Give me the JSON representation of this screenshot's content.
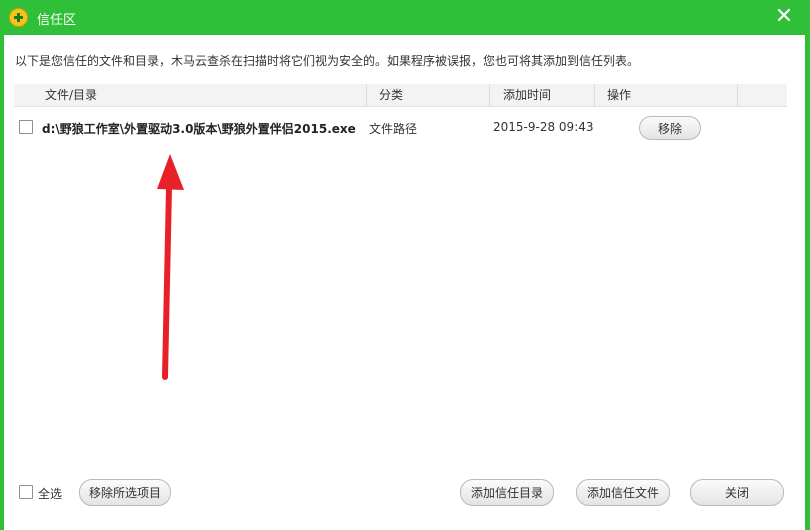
{
  "window": {
    "title": "信任区"
  },
  "description": "以下是您信任的文件和目录，木马云查杀在扫描时将它们视为安全的。如果程序被误报，您也可将其添加到信任列表。",
  "table": {
    "columns": [
      "文件/目录",
      "分类",
      "添加时间",
      "操作"
    ],
    "rows": [
      {
        "path": "d:\\野狼工作室\\外置驱动3.0版本\\野狼外置伴侣2015.exe",
        "category": "文件路径",
        "time": "2015-9-28 09:43",
        "action": "移除"
      }
    ]
  },
  "footer": {
    "select_all": "全选",
    "remove_selected": "移除所选项目",
    "add_trusted_dir": "添加信任目录",
    "add_trusted_file": "添加信任文件",
    "close": "关闭"
  },
  "colors": {
    "titlebar": "#2fbf38",
    "arrow": "#e8202a"
  },
  "icons": {
    "logo": "360-logo-icon",
    "close": "close-icon",
    "annotation": "red-arrow-annotation"
  }
}
